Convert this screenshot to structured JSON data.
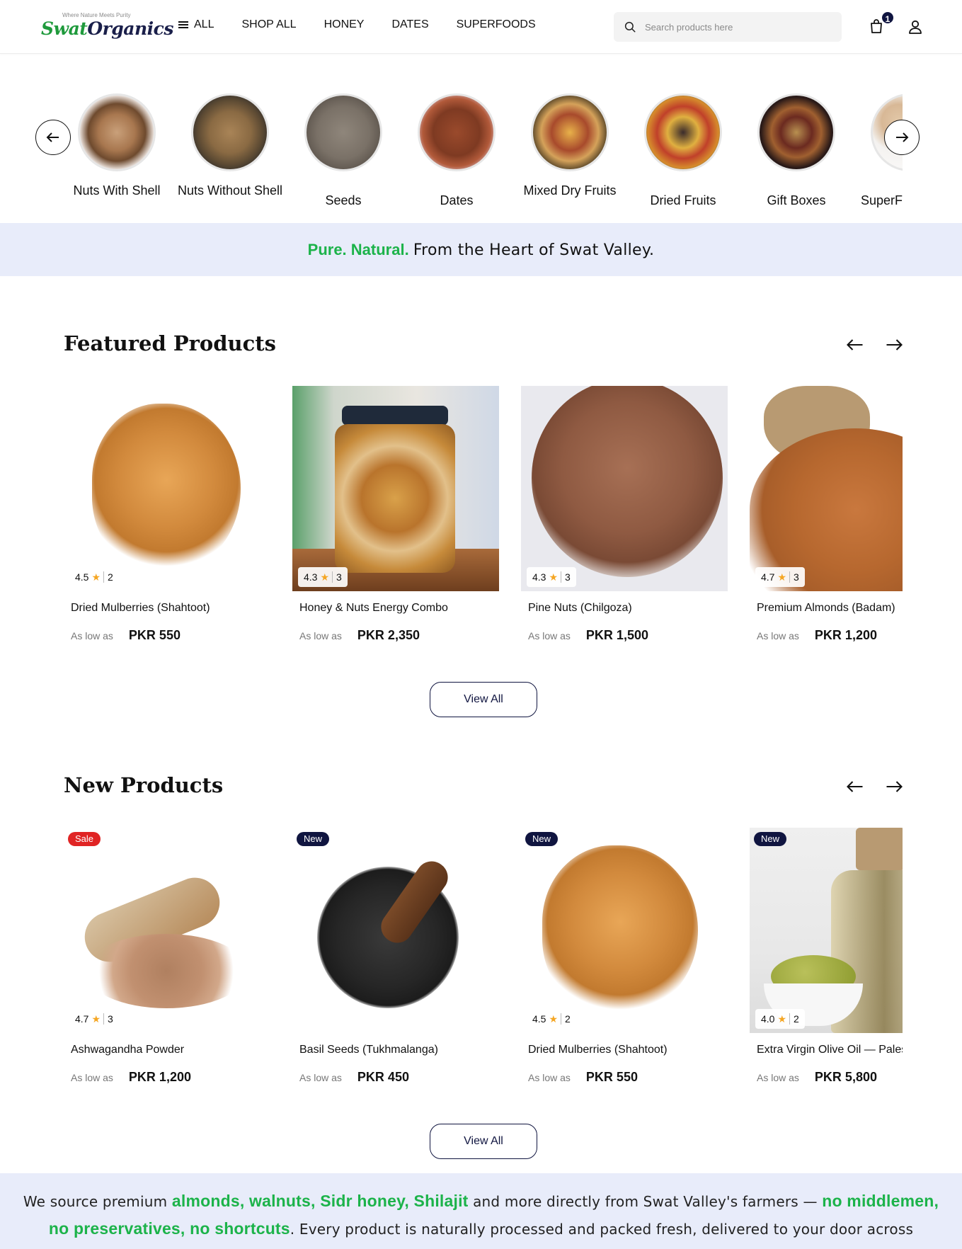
{
  "header": {
    "logo_tagline": "Where Nature Meets Purity",
    "logo_part1": "Swat",
    "logo_part2": "Organics",
    "nav": [
      "ALL",
      "SHOP ALL",
      "HONEY",
      "DATES",
      "SUPERFOODS"
    ],
    "search_placeholder": "Search products here",
    "cart_count": "1"
  },
  "categories": [
    {
      "label": "Nuts With Shell"
    },
    {
      "label": "Nuts Without Shell"
    },
    {
      "label": "Seeds"
    },
    {
      "label": "Dates"
    },
    {
      "label": "Mixed Dry Fruits"
    },
    {
      "label": "Dried Fruits"
    },
    {
      "label": "Gift Boxes"
    },
    {
      "label": "SuperF"
    }
  ],
  "banner": {
    "highlight": "Pure. Natural.",
    "rest": "From the Heart of Swat Valley."
  },
  "featured": {
    "title": "Featured Products",
    "view_all": "View All",
    "products": [
      {
        "name": "Dried Mulberries (Shahtoot)",
        "rating": "4.5",
        "reviews": "2",
        "low": "As low as",
        "price": "PKR 550"
      },
      {
        "name": "Honey & Nuts Energy Combo",
        "rating": "4.3",
        "reviews": "3",
        "low": "As low as",
        "price": "PKR 2,350"
      },
      {
        "name": "Pine Nuts (Chilgoza)",
        "rating": "4.3",
        "reviews": "3",
        "low": "As low as",
        "price": "PKR 1,500"
      },
      {
        "name": "Premium Almonds (Badam)",
        "rating": "4.7",
        "reviews": "3",
        "low": "As low as",
        "price": "PKR 1,200"
      }
    ]
  },
  "new_products": {
    "title": "New Products",
    "view_all": "View All",
    "products": [
      {
        "tag": "Sale",
        "name": "Ashwagandha Powder",
        "rating": "4.7",
        "reviews": "3",
        "low": "As low as",
        "price": "PKR 1,200"
      },
      {
        "tag": "New",
        "name": "Basil Seeds (Tukhmalanga)",
        "low": "As low as",
        "price": "PKR 450"
      },
      {
        "tag": "New",
        "name": "Dried Mulberries (Shahtoot)",
        "rating": "4.5",
        "reviews": "2",
        "low": "As low as",
        "price": "PKR 550"
      },
      {
        "tag": "New",
        "name": "Extra Virgin Olive Oil — Palestine",
        "rating": "4.0",
        "reviews": "2",
        "low": "As low as",
        "price": "PKR 5,800"
      }
    ]
  },
  "about": {
    "t1": "We source premium ",
    "h1": "almonds, walnuts, Sidr honey, Shilajit",
    "t2": " and more directly from Swat Valley's farmers — ",
    "h2": "no middlemen, no preservatives, no shortcuts",
    "t3": ". Every product is naturally processed and packed fresh, delivered to your door across Pakistan."
  },
  "colors": {
    "accent_green": "#1cb34a",
    "navy": "#101540",
    "sale_red": "#e02424",
    "banner_bg": "#e8ecfa",
    "star": "#f5a623"
  }
}
